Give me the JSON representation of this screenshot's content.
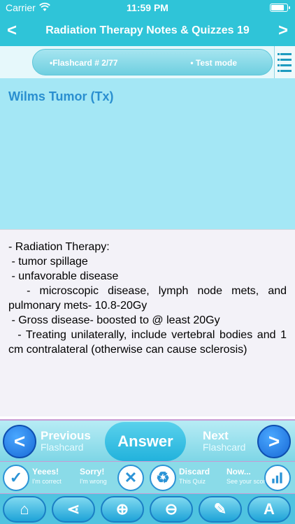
{
  "status_bar": {
    "carrier": "Carrier",
    "time": "11:59 PM"
  },
  "nav": {
    "back_symbol": "<",
    "title": "Radiation Therapy Notes & Quizzes 19",
    "forward_symbol": ">"
  },
  "card_bar": {
    "flashcard_label": "•Flashcard #  2/77",
    "mode_label": "• Test mode",
    "list_icon": "list-icon"
  },
  "question": {
    "title": "Wilms Tumor (Tx)"
  },
  "answer": {
    "lines": [
      "- Radiation Therapy:",
      " - tumor spillage",
      " - unfavorable disease",
      "  - microscopic disease, lymph node mets, and pulmonary mets- 10.8-20Gy",
      " - Gross disease- boosted to @ least 20Gy",
      "  - Treating unilaterally, include vertebral bodies and 1 cm contralateral (otherwise can cause sclerosis)"
    ]
  },
  "bottom_nav": {
    "previous": {
      "line1": "Previous",
      "line2": "Flashcard",
      "icon": "<"
    },
    "answer": "Answer",
    "next": {
      "line1": "Next",
      "line2": "Flashcard",
      "icon": ">"
    }
  },
  "actions": [
    {
      "line1": "Yeees!",
      "line2": "I'm correct",
      "icon": "check-icon"
    },
    {
      "line1": "Sorry!",
      "line2": "I'm wrong",
      "icon": "cross-icon"
    },
    {
      "line1": "Discard",
      "line2": "This Quiz",
      "icon": "recycle-icon"
    },
    {
      "line1": "Now...",
      "line2": "See your score",
      "icon": "chart-icon"
    }
  ],
  "toolbar": [
    "home-icon",
    "share-icon",
    "zoom-in-icon",
    "zoom-out-icon",
    "bookmark-icon",
    "font-icon"
  ],
  "colors": {
    "accent": "#2fc4d8",
    "question_bg": "#a4e7f5",
    "title_blue": "#2a8fd0",
    "answer_bg": "#f3f2f8"
  }
}
